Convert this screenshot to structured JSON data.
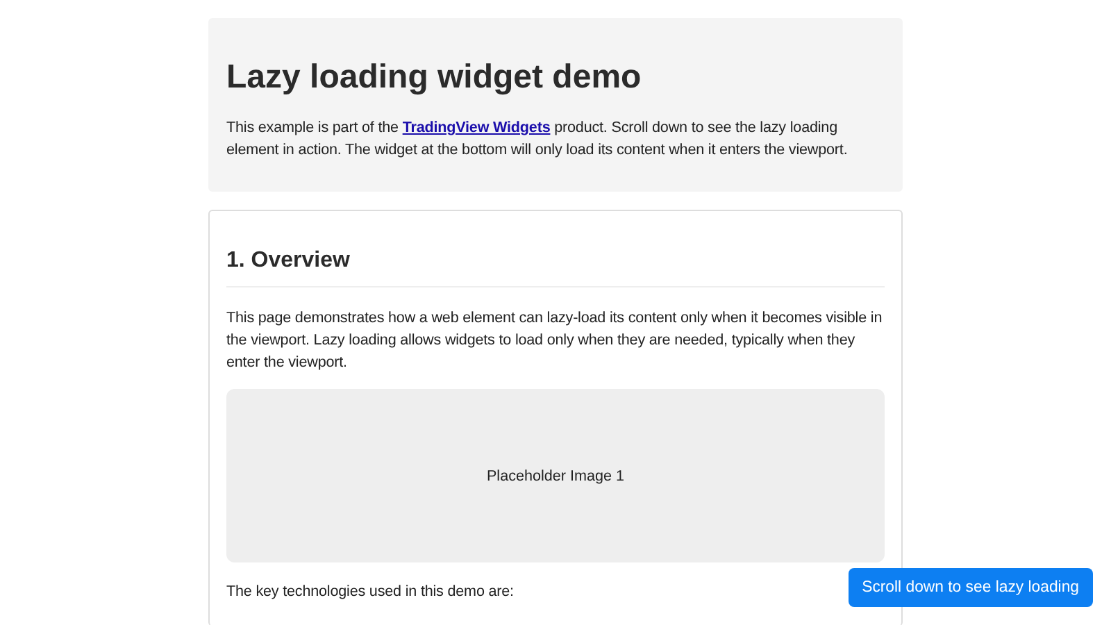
{
  "header": {
    "title": "Lazy loading widget demo",
    "intro_before": "This example is part of the ",
    "intro_link": "TradingView Widgets",
    "intro_after": " product. Scroll down to see the lazy loading element in action. The widget at the bottom will only load its content when it enters the viewport."
  },
  "section": {
    "heading": "1. Overview",
    "paragraph": "This page demonstrates how a web element can lazy-load its content only when it becomes visible in the viewport. Lazy loading allows widgets to load only when they are needed, typically when they enter the viewport.",
    "placeholder_label": "Placeholder Image 1",
    "technologies_intro": "The key technologies used in this demo are:"
  },
  "scroll_button": "Scroll down to see lazy loading"
}
